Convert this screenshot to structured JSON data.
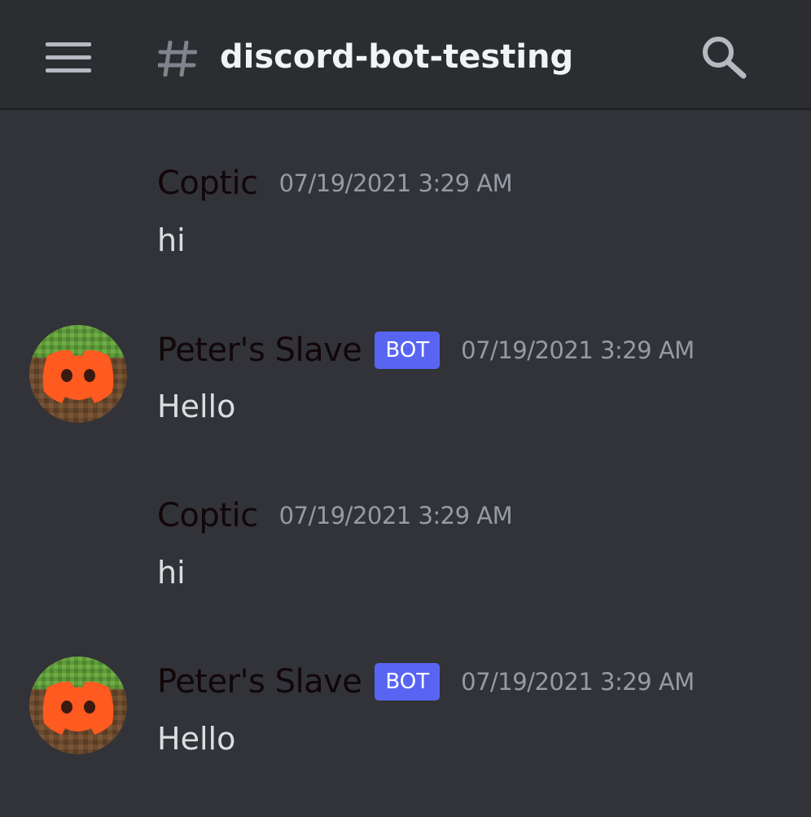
{
  "header": {
    "channel_name": "discord-bot-testing",
    "menu_icon": "hamburger-menu-icon",
    "channel_icon": "hash-icon",
    "search_icon": "search-icon"
  },
  "messages": [
    {
      "author": "Coptic",
      "timestamp": "07/19/2021 3:29 AM",
      "content": "hi",
      "is_bot": false,
      "has_avatar": false
    },
    {
      "author": "Peter's Slave",
      "badge": "BOT",
      "timestamp": "07/19/2021 3:29 AM",
      "content": "Hello",
      "is_bot": true,
      "has_avatar": true
    },
    {
      "author": "Coptic",
      "timestamp": "07/19/2021 3:29 AM",
      "content": "hi",
      "is_bot": false,
      "has_avatar": false
    },
    {
      "author": "Peter's Slave",
      "badge": "BOT",
      "timestamp": "07/19/2021 3:29 AM",
      "content": "Hello",
      "is_bot": true,
      "has_avatar": true
    }
  ],
  "colors": {
    "background": "#313338",
    "header_background": "#2b2d31",
    "bot_badge": "#5865f2",
    "avatar_logo": "#ff5a1f",
    "avatar_grass": "#5f9a3b",
    "avatar_dirt": "#6b4a2e"
  }
}
